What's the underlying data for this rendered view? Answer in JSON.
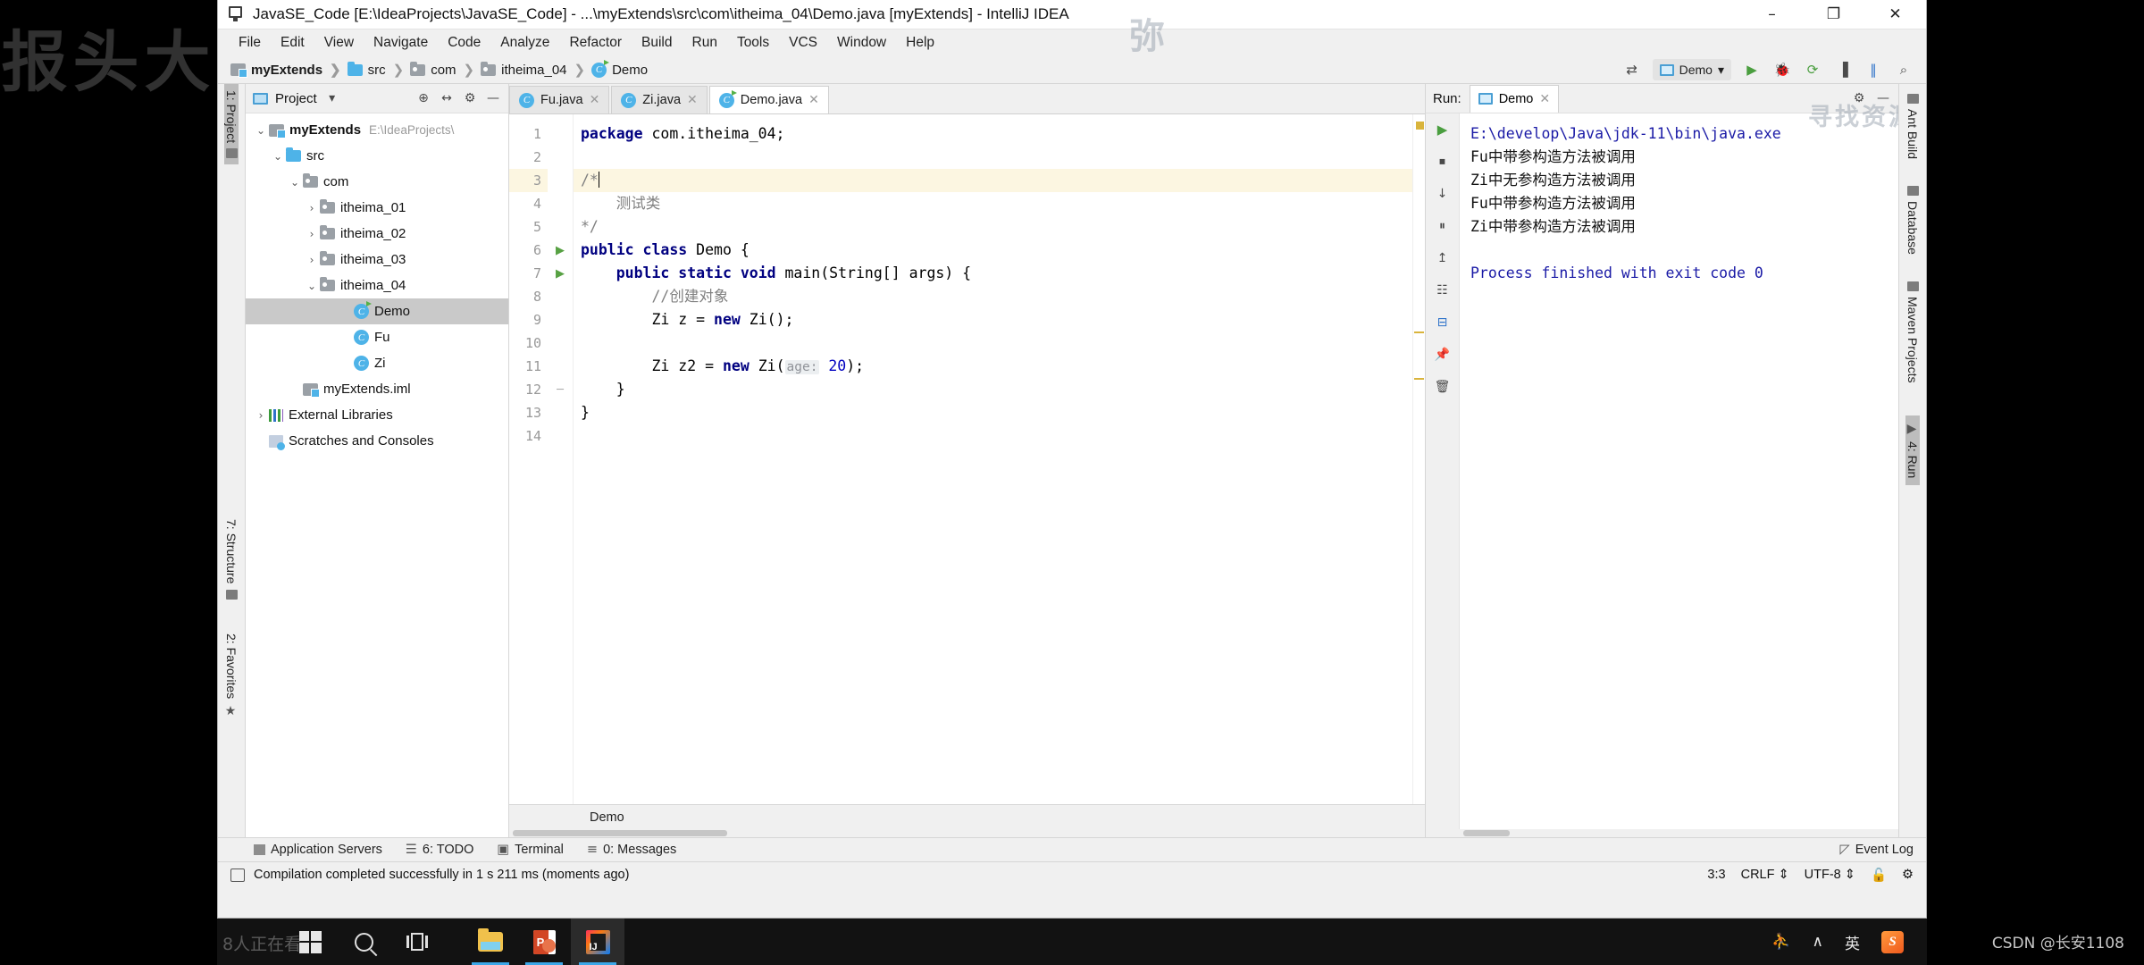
{
  "window": {
    "title": "JavaSE_Code [E:\\IdeaProjects\\JavaSE_Code] - ...\\myExtends\\src\\com\\itheima_04\\Demo.java [myExtends] - IntelliJ IDEA",
    "minimize": "–",
    "maximize": "❐",
    "close": "✕"
  },
  "menubar": [
    "File",
    "Edit",
    "View",
    "Navigate",
    "Code",
    "Analyze",
    "Refactor",
    "Build",
    "Run",
    "Tools",
    "VCS",
    "Window",
    "Help"
  ],
  "breadcrumb": [
    {
      "label": "myExtends",
      "icon": "module-icon"
    },
    {
      "label": "src",
      "icon": "source-folder-icon"
    },
    {
      "label": "com",
      "icon": "package-icon"
    },
    {
      "label": "itheima_04",
      "icon": "package-icon"
    },
    {
      "label": "Demo",
      "icon": "class-icon"
    }
  ],
  "toolbar": {
    "run_config": "Demo",
    "run_button": "▶",
    "debug_button": "🐞",
    "run_coverage_button": "⟳",
    "profile_button": "▐",
    "build_button": "‖",
    "search_button": "⌕",
    "sync_button": "⇄"
  },
  "watermarks": {
    "nav_overlay": "寻找资源",
    "top_overlay": "弥",
    "gutter_overlay": "报头大",
    "taskbar_overlay": "8人正在看",
    "csdn": "CSDN @长安1108"
  },
  "left_strip": [
    {
      "label": "1: Project",
      "active": true
    },
    {
      "label": "7: Structure",
      "active": false
    },
    {
      "label": "2: Favorites",
      "active": false
    }
  ],
  "right_strip": [
    {
      "label": "Ant Build",
      "active": false
    },
    {
      "label": "Database",
      "active": false
    },
    {
      "label": "Maven Projects",
      "active": false
    },
    {
      "label": "4: Run",
      "active": true
    }
  ],
  "project_panel": {
    "title": "Project",
    "dropdown": "▾",
    "actions": [
      "⊕",
      "↔",
      "⚙",
      "—"
    ],
    "tree": [
      {
        "indent": 0,
        "arrow": "⌄",
        "icon": "module-icon",
        "label": "myExtends",
        "path": "E:\\IdeaProjects\\",
        "bold": true,
        "selected": false
      },
      {
        "indent": 1,
        "arrow": "⌄",
        "icon": "source-folder-icon",
        "label": "src",
        "path": "",
        "bold": false,
        "selected": false
      },
      {
        "indent": 2,
        "arrow": "⌄",
        "icon": "package-icon",
        "label": "com",
        "path": "",
        "bold": false,
        "selected": false
      },
      {
        "indent": 3,
        "arrow": "›",
        "icon": "package-icon",
        "label": "itheima_01",
        "path": "",
        "bold": false,
        "selected": false
      },
      {
        "indent": 3,
        "arrow": "›",
        "icon": "package-icon",
        "label": "itheima_02",
        "path": "",
        "bold": false,
        "selected": false
      },
      {
        "indent": 3,
        "arrow": "›",
        "icon": "package-icon",
        "label": "itheima_03",
        "path": "",
        "bold": false,
        "selected": false
      },
      {
        "indent": 3,
        "arrow": "⌄",
        "icon": "package-icon",
        "label": "itheima_04",
        "path": "",
        "bold": false,
        "selected": false
      },
      {
        "indent": 5,
        "arrow": "",
        "icon": "runnable-class-icon",
        "label": "Demo",
        "path": "",
        "bold": false,
        "selected": true
      },
      {
        "indent": 5,
        "arrow": "",
        "icon": "class-icon",
        "label": "Fu",
        "path": "",
        "bold": false,
        "selected": false
      },
      {
        "indent": 5,
        "arrow": "",
        "icon": "class-icon",
        "label": "Zi",
        "path": "",
        "bold": false,
        "selected": false
      },
      {
        "indent": 2,
        "arrow": "",
        "icon": "iml-icon",
        "label": "myExtends.iml",
        "path": "",
        "bold": false,
        "selected": false
      },
      {
        "indent": 0,
        "arrow": "›",
        "icon": "libraries-icon",
        "label": "External Libraries",
        "path": "",
        "bold": false,
        "selected": false
      },
      {
        "indent": 0,
        "arrow": "",
        "icon": "scratches-icon",
        "label": "Scratches and Consoles",
        "path": "",
        "bold": false,
        "selected": false
      }
    ]
  },
  "editor": {
    "tabs": [
      {
        "label": "Fu.java",
        "icon": "class-icon",
        "active": false
      },
      {
        "label": "Zi.java",
        "icon": "class-icon",
        "active": false
      },
      {
        "label": "Demo.java",
        "icon": "runnable-class-icon",
        "active": true
      }
    ],
    "line_numbers": [
      "1",
      "2",
      "3",
      "4",
      "5",
      "6",
      "7",
      "8",
      "9",
      "10",
      "11",
      "12",
      "13",
      "14"
    ],
    "highlight_line": 3,
    "lines": [
      {
        "n": 1,
        "html": "<span class=\"kw\">package</span> com.itheima_04;"
      },
      {
        "n": 2,
        "html": ""
      },
      {
        "n": 3,
        "html": "<span class=\"cmt\">/*</span><span class=\"caret\"></span>"
      },
      {
        "n": 4,
        "html": "<span class=\"cmt\">    测试类</span>"
      },
      {
        "n": 5,
        "html": "<span class=\"cmt\">*/</span>"
      },
      {
        "n": 6,
        "html": "<span class=\"kw\">public class</span> Demo {"
      },
      {
        "n": 7,
        "html": "    <span class=\"kw\">public static void</span> main(String[] args) {"
      },
      {
        "n": 8,
        "html": "        <span class=\"cmt\">//创建对象</span>"
      },
      {
        "n": 9,
        "html": "        Zi z = <span class=\"kw\">new</span> Zi();"
      },
      {
        "n": 10,
        "html": ""
      },
      {
        "n": 11,
        "html": "        Zi z2 = <span class=\"kw\">new</span> Zi(<span class=\"hint\">age:</span> <span class=\"num\">20</span>);"
      },
      {
        "n": 12,
        "html": "    }"
      },
      {
        "n": 13,
        "html": "}"
      },
      {
        "n": 14,
        "html": ""
      }
    ],
    "gutter_marks": [
      {
        "n": 6,
        "mark": "run"
      },
      {
        "n": 7,
        "mark": "run"
      },
      {
        "n": 7,
        "mark": "fold"
      },
      {
        "n": 12,
        "mark": "fold"
      }
    ],
    "breadcrumb_status": "Demo"
  },
  "run_panel": {
    "label": "Run:",
    "tab": "Demo",
    "close": "✕",
    "settings": "⚙",
    "minimize": "—",
    "actions": [
      "▶",
      "⏹",
      "↓",
      "⏸",
      "↥",
      "☷",
      "⊟",
      "📌",
      "🗑"
    ],
    "console_lines": [
      {
        "text": "E:\\develop\\Java\\jdk-11\\bin\\java.exe",
        "color": "blue"
      },
      {
        "text": "Fu中带参构造方法被调用",
        "color": "black"
      },
      {
        "text": "Zi中无参构造方法被调用",
        "color": "black"
      },
      {
        "text": "Fu中带参构造方法被调用",
        "color": "black"
      },
      {
        "text": "Zi中带参构造方法被调用",
        "color": "black"
      },
      {
        "text": "",
        "color": "black"
      },
      {
        "text": "Process finished with exit code 0",
        "color": "blue"
      }
    ]
  },
  "bottom_toolwindows": [
    {
      "label": "Application Servers",
      "icon": "servers-icon"
    },
    {
      "label": "6: TODO",
      "icon": "todo-icon"
    },
    {
      "label": "Terminal",
      "icon": "terminal-icon"
    },
    {
      "label": "0: Messages",
      "icon": "messages-icon"
    },
    {
      "label": "Event Log",
      "icon": "event-log-icon"
    }
  ],
  "statusbar": {
    "message": "Compilation completed successfully in 1 s 211 ms (moments ago)",
    "caret": "3:3",
    "line_separator": "CRLF",
    "encoding": "UTF-8",
    "lock": "🔓",
    "inspection": "⚙"
  },
  "taskbar": {
    "items": [
      {
        "name": "start-button",
        "icon": "windows-logo-icon"
      },
      {
        "name": "search-button",
        "icon": "search-icon"
      },
      {
        "name": "task-view-button",
        "icon": "task-view-icon"
      },
      {
        "name": "file-explorer",
        "icon": "folder-icon",
        "running": true
      },
      {
        "name": "powerpoint",
        "icon": "powerpoint-icon",
        "running": true
      },
      {
        "name": "intellij-idea",
        "icon": "intellij-icon",
        "running": true,
        "active": true
      }
    ],
    "tray": [
      {
        "name": "people-icon",
        "glyph": "⛹"
      },
      {
        "name": "show-hidden-icons",
        "glyph": "∧"
      },
      {
        "name": "ime-language-indicator",
        "glyph": "英"
      },
      {
        "name": "sogou-input",
        "glyph": "S"
      }
    ]
  },
  "colors": {
    "accent": "#4eb3e8",
    "keyword": "#000080",
    "comment": "#808080",
    "console_blue": "#1a1aa6",
    "highlight_line": "#fcf6e1",
    "selection": "#c9c9c9",
    "marker_yellow": "#d9b43c"
  }
}
